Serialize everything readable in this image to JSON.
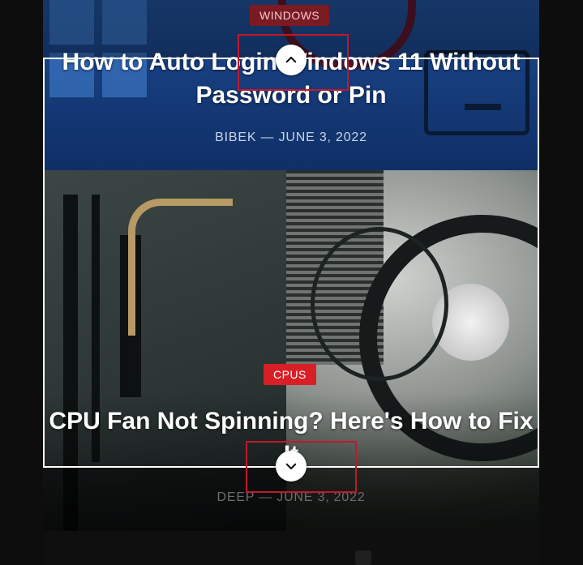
{
  "articles": [
    {
      "category": "WINDOWS",
      "title": "How to Auto Login Windows 11 Without Password or Pin",
      "author": "BIBEK",
      "date": "JUNE 3, 2022",
      "byline": "BIBEK — JUNE 3, 2022"
    },
    {
      "category": "CPUS",
      "title": "CPU Fan Not Spinning? Here's How to Fix It",
      "author": "DEEP",
      "date": "JUNE 3, 2022",
      "byline": "DEEP — JUNE 3, 2022"
    }
  ],
  "controls": {
    "scroll_up_icon": "chevron-up-icon",
    "scroll_down_icon": "chevron-down-icon"
  },
  "colors": {
    "badge_red": "#d91f26",
    "frame": "#ffffff",
    "highlight": "#c0182c"
  }
}
